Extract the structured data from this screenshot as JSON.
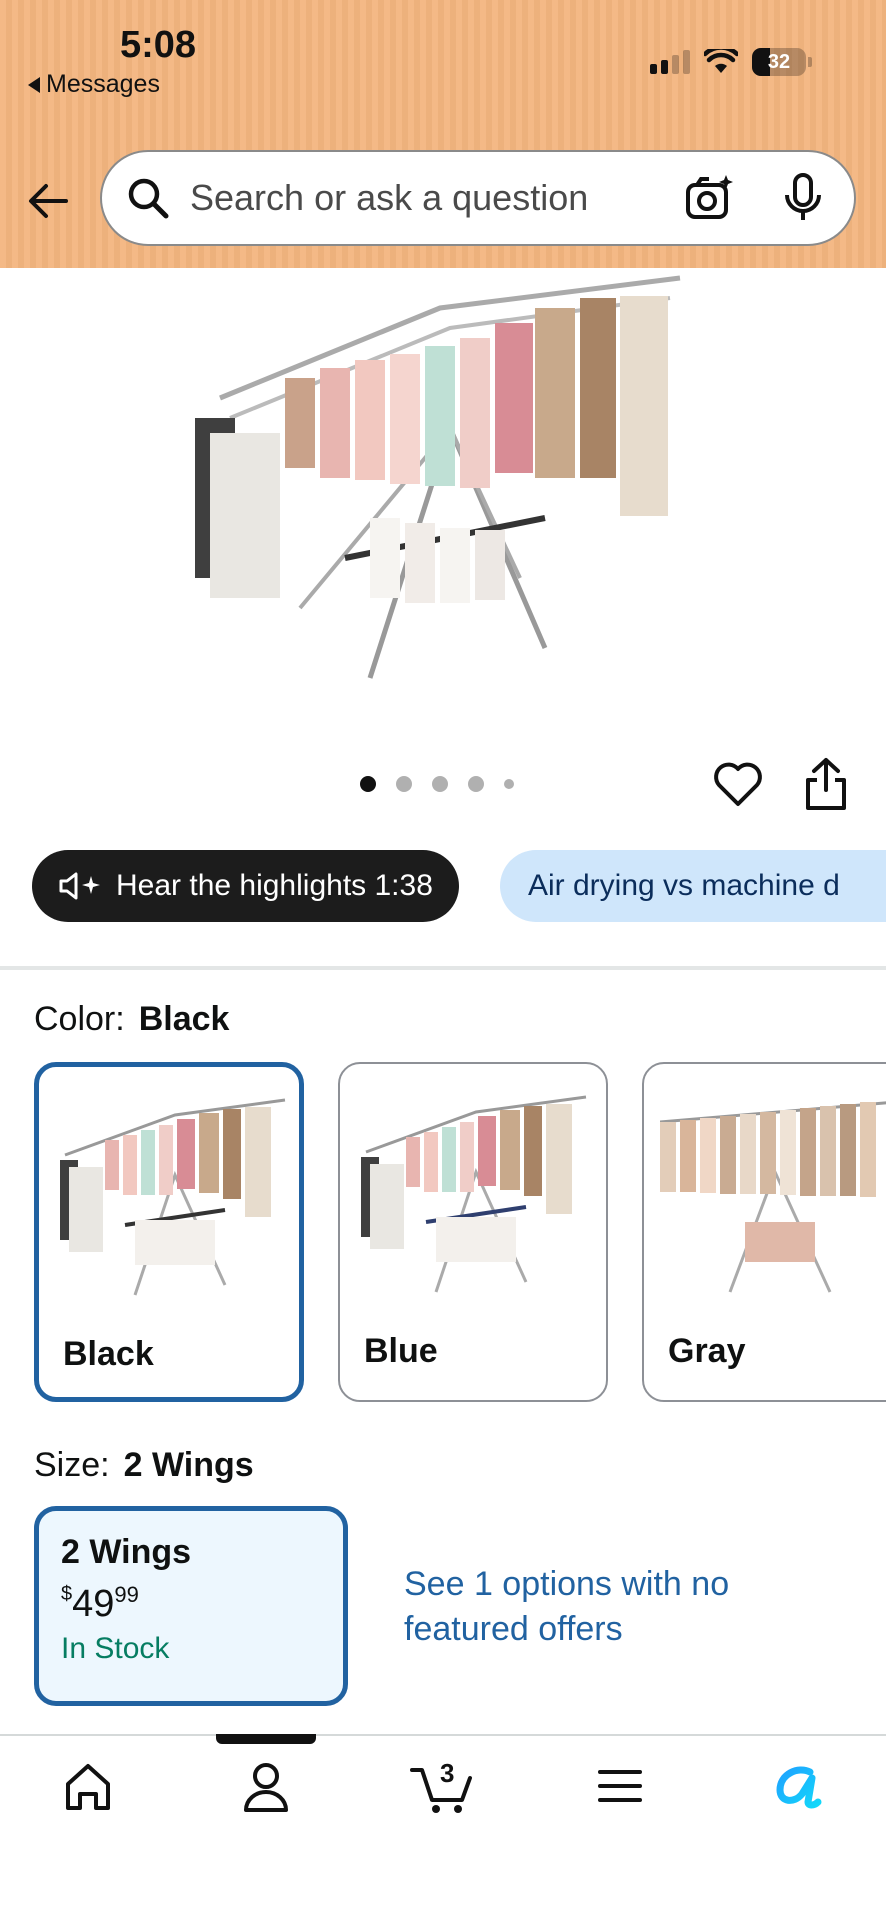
{
  "status_bar": {
    "time": "5:08",
    "back_app_label": "Messages",
    "battery": "32"
  },
  "search": {
    "placeholder": "Search or ask a question"
  },
  "gallery": {
    "dots": 5,
    "active_dot": 1
  },
  "highlights": {
    "hear_label": "Hear the highlights 1:38",
    "topic_label": "Air drying vs machine d"
  },
  "color": {
    "label": "Color:",
    "selected": "Black",
    "options": [
      {
        "name": "Black",
        "selected": true
      },
      {
        "name": "Blue",
        "selected": false
      },
      {
        "name": "Gray",
        "selected": false
      }
    ]
  },
  "size": {
    "label": "Size:",
    "selected": "2 Wings",
    "card": {
      "name": "2 Wings",
      "currency": "$",
      "price_whole": "49",
      "price_cents": "99",
      "stock": "In Stock"
    },
    "other_options_text": "See 1 options with no featured offers"
  },
  "bottom_nav": {
    "items": [
      "home-icon",
      "account-icon",
      "cart-icon",
      "menu-icon",
      "rufus-icon"
    ],
    "cart_count": "3"
  },
  "colors": {
    "header_bg": "#f3b57f",
    "link_blue": "#2162a1",
    "stock_green": "#067d62",
    "selected_border": "#2162a1"
  }
}
